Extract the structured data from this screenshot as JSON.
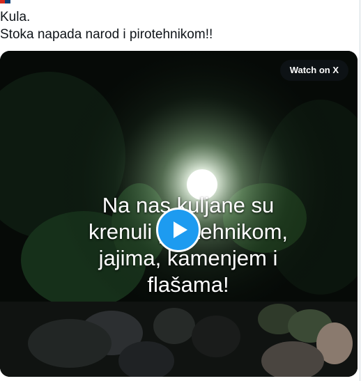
{
  "tweet": {
    "lines": [
      "Kula.",
      "Stoka napada narod i pirotehnikom!!"
    ]
  },
  "media": {
    "watch_label": "Watch on X",
    "caption_lines": [
      "Na nas kuljane su",
      "krenuli pirotehnikom,",
      "jajima, kamenjem i",
      "flašama!"
    ],
    "play_button": {
      "icon": "play-icon",
      "color": "#1d9bf0"
    }
  },
  "colors": {
    "text": "#0f1419",
    "accent": "#1d9bf0",
    "border": "#cfd9de"
  }
}
